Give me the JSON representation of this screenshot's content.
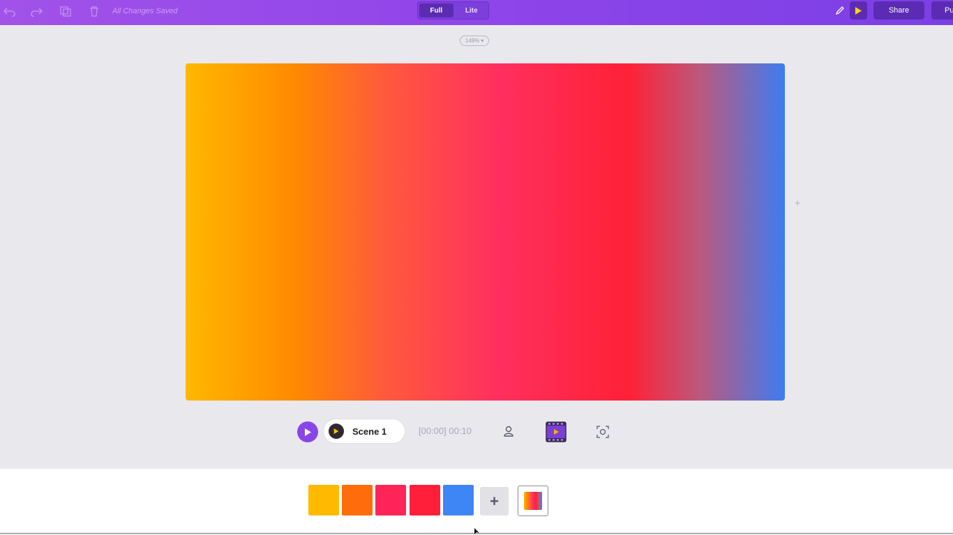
{
  "topbar": {
    "status_text": "All Changes Saved",
    "modes": [
      "Full",
      "Lite"
    ],
    "active_mode": "Full",
    "share_label": "Share",
    "publish_label": "Pu",
    "icons": [
      "undo-icon",
      "redo-icon",
      "copy-icon",
      "delete-icon",
      "edit-icon",
      "play-icon"
    ]
  },
  "zoom": {
    "label": "149%"
  },
  "canvas": {
    "gradient_stops": [
      "#ffb800",
      "#ff8a00",
      "#ff5a3c",
      "#ff2f5f",
      "#ff2136",
      "#b95a7e",
      "#3f7cf0"
    ]
  },
  "playback": {
    "scene_label": "Scene 1",
    "timecode": "[00:00] 00:10"
  },
  "palette": {
    "swatches": [
      "#ffba00",
      "#ff6d0b",
      "#ff2458",
      "#ff1f3a",
      "#3e86f5"
    ],
    "add_label": "+"
  }
}
